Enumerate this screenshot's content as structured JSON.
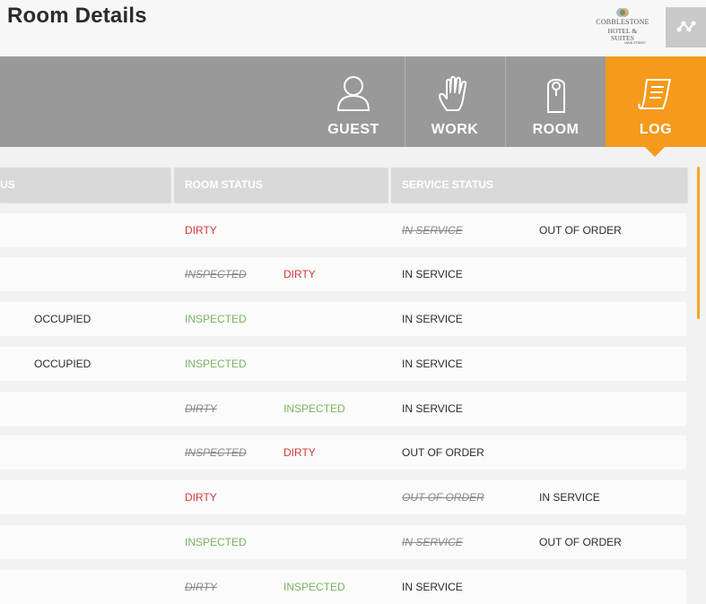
{
  "header": {
    "title": "Room Details",
    "logo": {
      "line1": "COBBLESTONE",
      "line2": "HOTEL & SUITES",
      "line3": "MAIN STREET"
    },
    "share_icon": "share-nodes-icon"
  },
  "nav": {
    "tabs": [
      {
        "label": "GUEST",
        "icon": "person-icon"
      },
      {
        "label": "WORK",
        "icon": "hand-icon"
      },
      {
        "label": "ROOM",
        "icon": "door-hanger-icon"
      },
      {
        "label": "LOG",
        "icon": "scroll-icon",
        "active": true
      }
    ],
    "active_color": "#f59a1b"
  },
  "table": {
    "columns": [
      "ATUS",
      "ROOM STATUS",
      "SERVICE STATUS"
    ],
    "rows": [
      {
        "occupancy": "",
        "room_prev": "",
        "room": "DIRTY",
        "service_prev": "IN SERVICE",
        "service": "OUT OF ORDER"
      },
      {
        "occupancy": "",
        "room_prev": "INSPECTED",
        "room": "DIRTY",
        "service_prev": "",
        "service": "IN SERVICE"
      },
      {
        "occupancy": "OCCUPIED",
        "room_prev": "",
        "room": "INSPECTED",
        "service_prev": "",
        "service": "IN SERVICE"
      },
      {
        "occupancy": "OCCUPIED",
        "room_prev": "",
        "room": "INSPECTED",
        "service_prev": "",
        "service": "IN SERVICE"
      },
      {
        "occupancy": "",
        "room_prev": "DIRTY",
        "room": "INSPECTED",
        "service_prev": "",
        "service": "IN SERVICE"
      },
      {
        "occupancy": "",
        "room_prev": "INSPECTED",
        "room": "DIRTY",
        "service_prev": "",
        "service": "OUT OF ORDER"
      },
      {
        "occupancy": "",
        "room_prev": "",
        "room": "DIRTY",
        "service_prev": "OUT OF ORDER",
        "service": "IN SERVICE"
      },
      {
        "occupancy": "",
        "room_prev": "",
        "room": "INSPECTED",
        "service_prev": "IN SERVICE",
        "service": "OUT OF ORDER"
      },
      {
        "occupancy": "",
        "room_prev": "DIRTY",
        "room": "INSPECTED",
        "service_prev": "",
        "service": "IN SERVICE"
      }
    ]
  },
  "colors": {
    "dirty": "#d23a3a",
    "inspected": "#7ab35f",
    "accent": "#f59a1b"
  }
}
